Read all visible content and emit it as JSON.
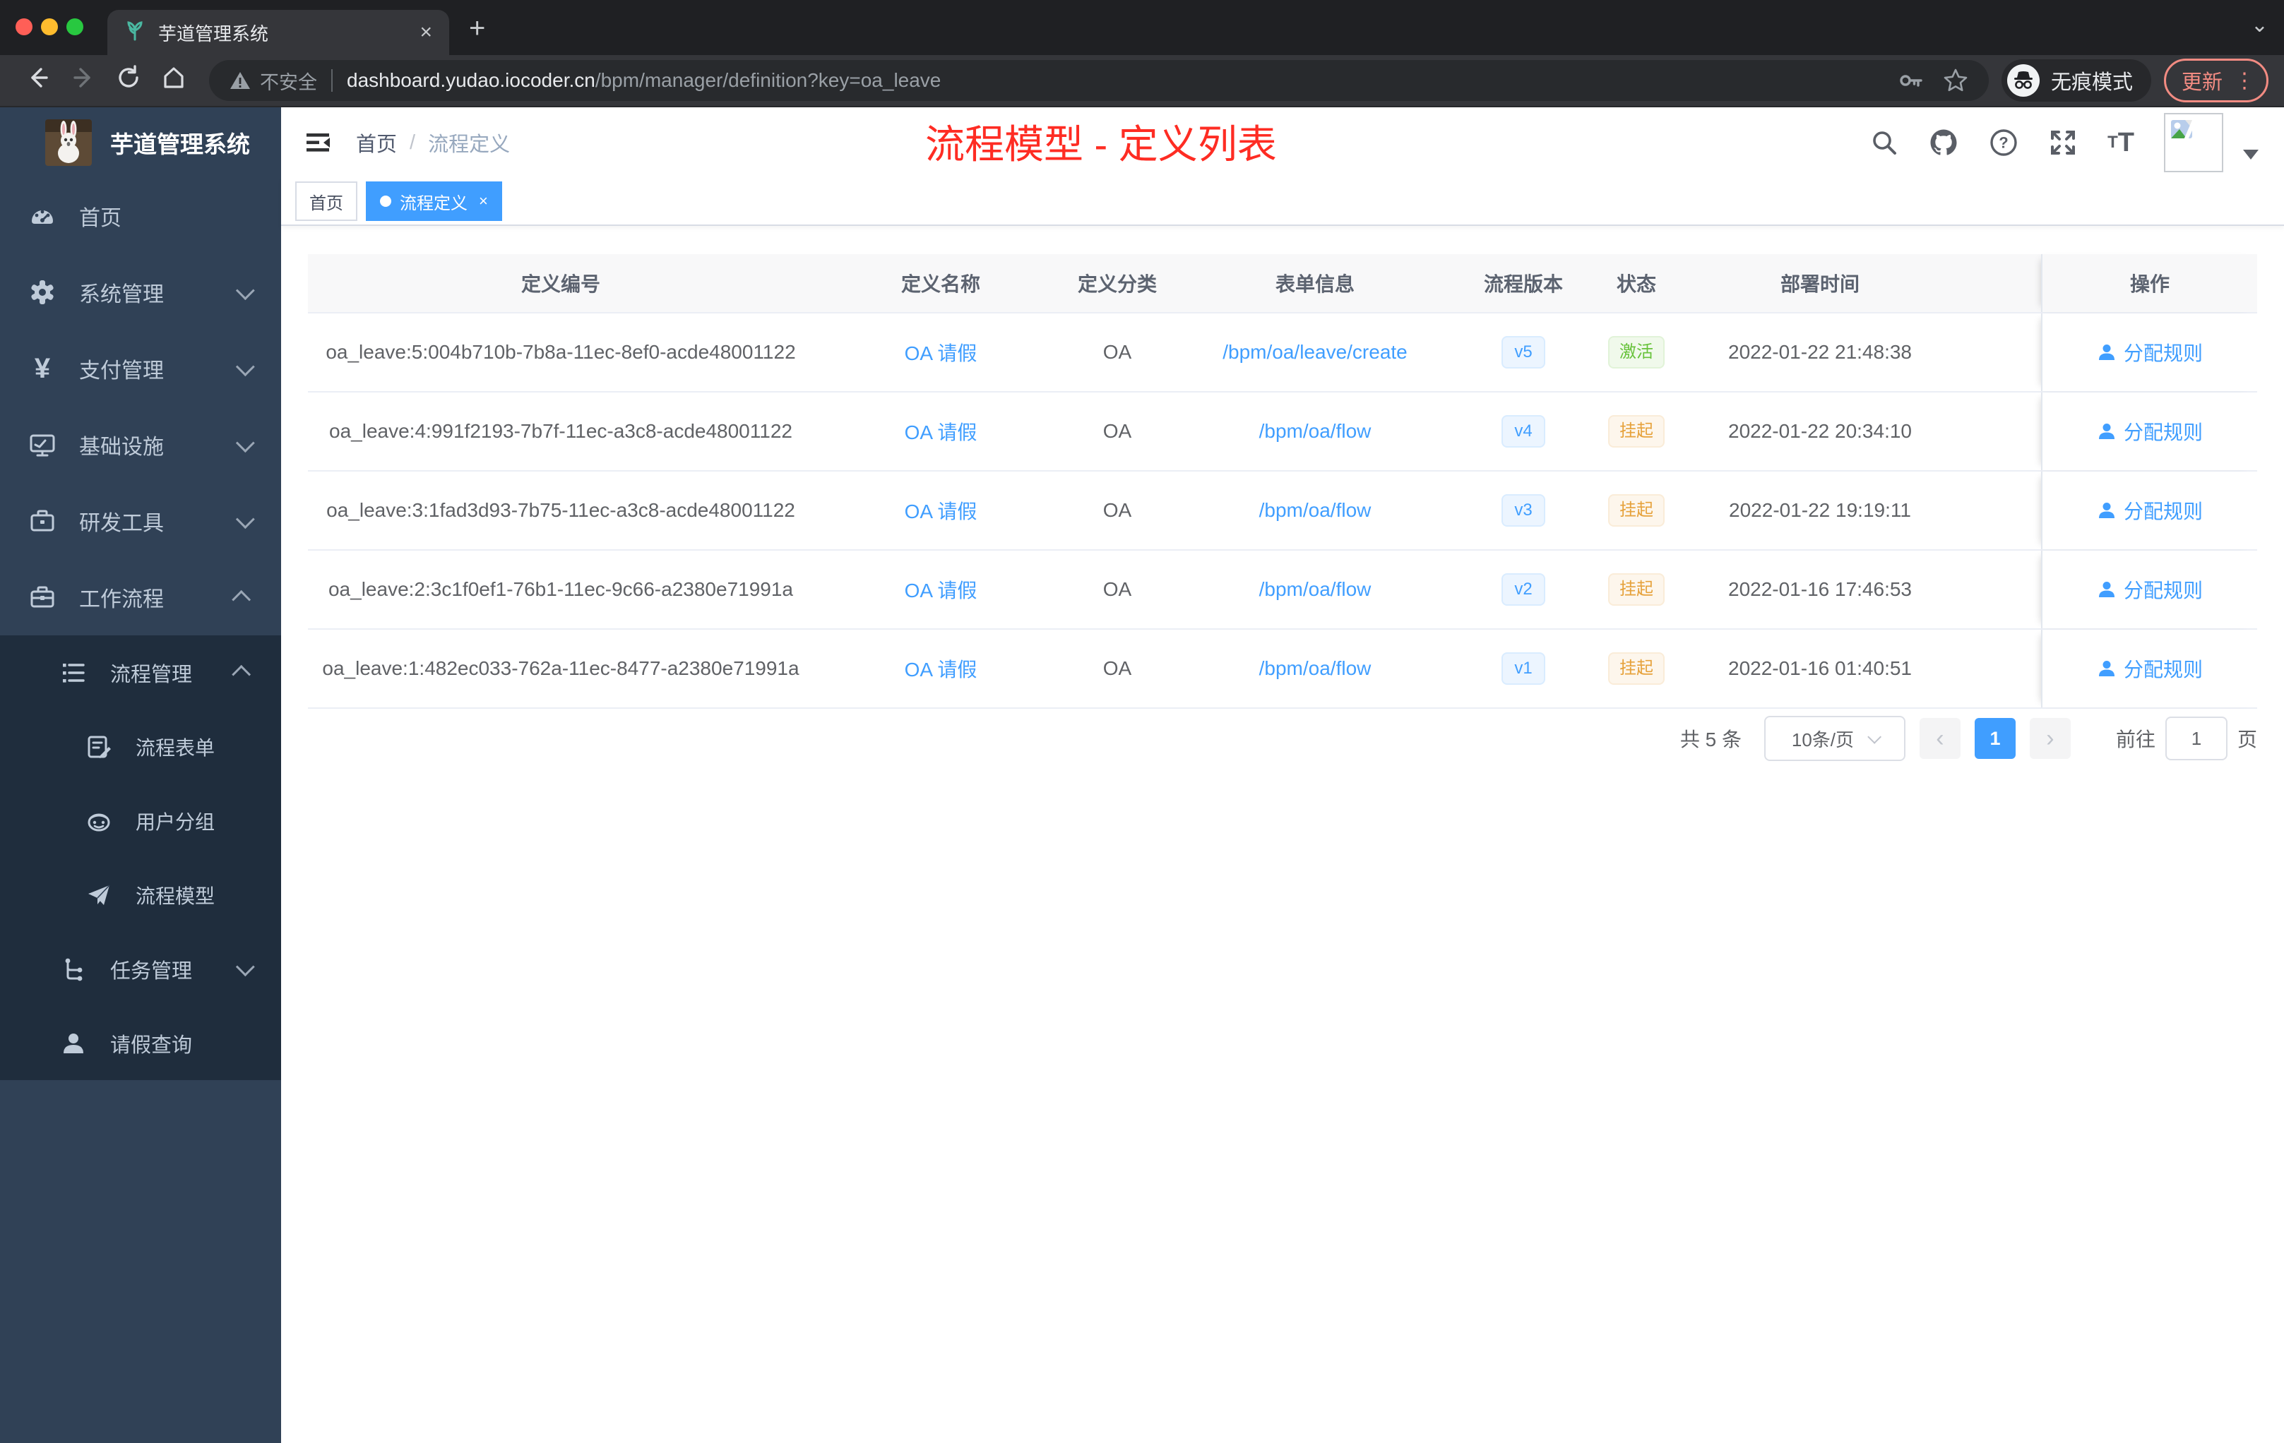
{
  "browser": {
    "tab_title": "芋道管理系统",
    "close_tab": "×",
    "new_tab": "+",
    "window_chevron": "⌄",
    "not_secure": "不安全",
    "url_host": "dashboard.yudao.iocoder.cn",
    "url_path": "/bpm/manager/definition?key=oa_leave",
    "incognito_label": "无痕模式",
    "update_label": "更新",
    "menu_dots": "⋮"
  },
  "sidebar": {
    "logo_title": "芋道管理系统",
    "items": [
      {
        "label": "首页",
        "icon": "dashboard-icon"
      },
      {
        "label": "系统管理",
        "icon": "gear-icon",
        "chevron": "down"
      },
      {
        "label": "支付管理",
        "icon": "yen-icon",
        "chevron": "down"
      },
      {
        "label": "基础设施",
        "icon": "monitor-icon",
        "chevron": "down"
      },
      {
        "label": "研发工具",
        "icon": "toolbox-icon",
        "chevron": "down"
      },
      {
        "label": "工作流程",
        "icon": "briefcase-icon",
        "chevron": "up"
      },
      {
        "label": "流程管理",
        "icon": "list-icon",
        "chevron": "up"
      },
      {
        "label": "流程表单",
        "icon": "form-icon"
      },
      {
        "label": "用户分组",
        "icon": "robot-icon"
      },
      {
        "label": "流程模型",
        "icon": "send-icon"
      },
      {
        "label": "任务管理",
        "icon": "tree-icon",
        "chevron": "down"
      },
      {
        "label": "请假查询",
        "icon": "user-icon"
      }
    ]
  },
  "header": {
    "breadcrumb": {
      "home": "首页",
      "separator": "/",
      "current": "流程定义"
    },
    "annotation": "流程模型 - 定义列表"
  },
  "tags": [
    {
      "label": "首页",
      "active": false
    },
    {
      "label": "流程定义",
      "active": true,
      "close": "×"
    }
  ],
  "table": {
    "columns": [
      "定义编号",
      "定义名称",
      "定义分类",
      "表单信息",
      "流程版本",
      "状态",
      "部署时间",
      "操作"
    ],
    "action_label": "分配规则",
    "rows": [
      {
        "id": "oa_leave:5:004b710b-7b8a-11ec-8ef0-acde48001122",
        "name": "OA 请假",
        "category": "OA",
        "form": "/bpm/oa/leave/create",
        "version": "v5",
        "status": "激活",
        "status_type": "active",
        "time": "2022-01-22 21:48:38"
      },
      {
        "id": "oa_leave:4:991f2193-7b7f-11ec-a3c8-acde48001122",
        "name": "OA 请假",
        "category": "OA",
        "form": "/bpm/oa/flow",
        "version": "v4",
        "status": "挂起",
        "status_type": "suspended",
        "time": "2022-01-22 20:34:10"
      },
      {
        "id": "oa_leave:3:1fad3d93-7b75-11ec-a3c8-acde48001122",
        "name": "OA 请假",
        "category": "OA",
        "form": "/bpm/oa/flow",
        "version": "v3",
        "status": "挂起",
        "status_type": "suspended",
        "time": "2022-01-22 19:19:11"
      },
      {
        "id": "oa_leave:2:3c1f0ef1-76b1-11ec-9c66-a2380e71991a",
        "name": "OA 请假",
        "category": "OA",
        "form": "/bpm/oa/flow",
        "version": "v2",
        "status": "挂起",
        "status_type": "suspended",
        "time": "2022-01-16 17:46:53"
      },
      {
        "id": "oa_leave:1:482ec033-762a-11ec-8477-a2380e71991a",
        "name": "OA 请假",
        "category": "OA",
        "form": "/bpm/oa/flow",
        "version": "v1",
        "status": "挂起",
        "status_type": "suspended",
        "time": "2022-01-16 01:40:51"
      }
    ]
  },
  "pagination": {
    "total": "共 5 条",
    "page_size": "10条/页",
    "prev": "‹",
    "next": "›",
    "current_page": "1",
    "goto_label": "前往",
    "goto_value": "1",
    "page_unit": "页"
  },
  "colors": {
    "accent": "#409eff",
    "sidebar_bg": "#304156",
    "submenu_bg": "#1f2d3d",
    "status_active": "#67c23a",
    "status_suspended": "#e6a23c",
    "annotation_red": "#fe2c23"
  }
}
